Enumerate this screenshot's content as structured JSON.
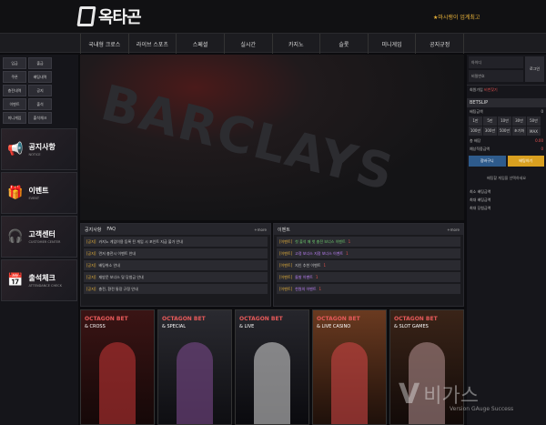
{
  "header": {
    "logo_text": "옥타곤",
    "notice": "★마시랭이 업계최고"
  },
  "nav": [
    "국내형 크로스",
    "라이브 스포츠",
    "스페셜",
    "실시간",
    "카지노",
    "슬롯",
    "미니게임",
    "공지규정"
  ],
  "left": {
    "grid": [
      "입금",
      "출금",
      "쿠폰",
      "배팅내역",
      "충전내역",
      "공지",
      "이벤트",
      "출석",
      "미니게임",
      "출석체크"
    ],
    "promos": [
      {
        "title": "공지사항",
        "sub": "NOTICE",
        "icon": "megaphone-icon"
      },
      {
        "title": "이벤트",
        "sub": "EVENT",
        "icon": "gift-icon"
      },
      {
        "title": "고객센터",
        "sub": "CUSTOMER CENTER",
        "icon": "headset-icon"
      },
      {
        "title": "출석체크",
        "sub": "ATTENDANCE CHECK",
        "icon": "calendar-icon"
      }
    ]
  },
  "banner": {
    "text": "BARCLAYS"
  },
  "notice_panel": {
    "tabs": [
      "공지사항",
      "FAQ"
    ],
    "more": "+more",
    "rows": [
      {
        "tag": "[공지]",
        "text": "카지노 게임이용 등록 된 게임 시 포인트 지급 불가 안내",
        "n": ""
      },
      {
        "tag": "[공지]",
        "text": "먼저 충전시 이벤트 안내",
        "n": ""
      },
      {
        "tag": "[공지]",
        "text": "배팅취소 안내",
        "n": ""
      },
      {
        "tag": "[공지]",
        "text": "재방문 보너스 및 당첨금 안내",
        "n": ""
      },
      {
        "tag": "[공지]",
        "text": "충전, 환전 통장 규정 안내",
        "n": ""
      }
    ]
  },
  "event_panel": {
    "tab": "이벤트",
    "more": "+more",
    "rows": [
      {
        "tag": "[이벤트]",
        "text": "첫 출석 매 첫 충전 보너스 이벤트",
        "n": "1",
        "c": "g"
      },
      {
        "tag": "[이벤트]",
        "text": "고정 보너스 지정 보너스 이벤트",
        "n": "1",
        "c": "p"
      },
      {
        "tag": "[이벤트]",
        "text": "지인 추천 이벤트",
        "n": "1",
        "c": ""
      },
      {
        "tag": "[이벤트]",
        "text": "돌발 이벤트",
        "n": "1",
        "c": "p"
      },
      {
        "tag": "[이벤트]",
        "text": "천원의 이벤트",
        "n": "1",
        "c": "p"
      }
    ]
  },
  "cards": [
    {
      "brand": "OCTAGON BET",
      "label": "& CROSS",
      "bg": "#3a1414"
    },
    {
      "brand": "OCTAGON BET",
      "label": "& SPECIAL",
      "bg": "#242428"
    },
    {
      "brand": "OCTAGON BET",
      "label": "& LIVE",
      "bg": "#1e1e24"
    },
    {
      "brand": "OCTAGON BET",
      "label": "& LIVE CASINO",
      "bg": "#4a2a1c"
    },
    {
      "brand": "OCTAGON BET",
      "label": "& SLOT GAMES",
      "bg": "#2a1c18"
    }
  ],
  "right": {
    "login": {
      "id_placeholder": "아이디",
      "pw_placeholder": "비밀번호",
      "button": "로그인"
    },
    "user_line": {
      "label": "회원가입",
      "value": "비번찾기"
    },
    "betslip_title": "BETSLIP",
    "rows": [
      {
        "k": "배팅금액",
        "v": "0"
      },
      {
        "k": "총 배당",
        "v": "0.00"
      },
      {
        "k": "예상적중금액",
        "v": "0"
      }
    ],
    "chips": [
      "1만",
      "5만",
      "10만",
      "30만",
      "50만",
      "100만",
      "300만",
      "500만",
      "초기화",
      "MAX"
    ],
    "cart_label": "장바구니",
    "bet_label": "배팅하기",
    "empty": "배팅할 게임을 선택하세요",
    "limits": [
      {
        "k": "최소 배팅금액",
        "v": ""
      },
      {
        "k": "최대 배팅금액",
        "v": ""
      },
      {
        "k": "최대 당첨금액",
        "v": ""
      }
    ]
  },
  "watermark": {
    "logo": "V",
    "name": "비가스",
    "tagline": "Version GAuge Success"
  },
  "colors": {
    "accent": "#e8b23a",
    "red": "#e05050",
    "blue": "#2e5b8c"
  }
}
